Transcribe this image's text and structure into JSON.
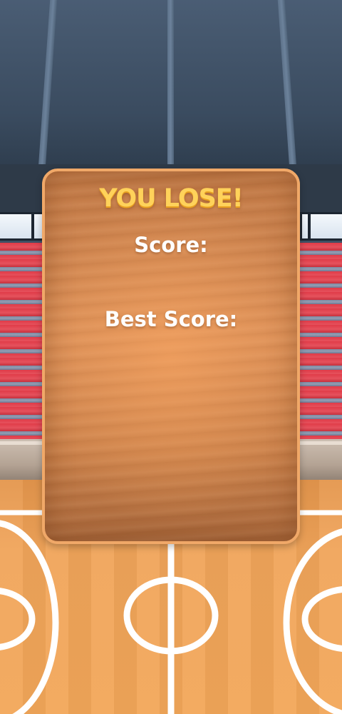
{
  "game": {
    "result_title": "YOU LOSE!",
    "score_label": "Score:",
    "score_value": "",
    "best_score_label": "Best Score:",
    "best_score_value": ""
  },
  "colors": {
    "title": "#ffd25a",
    "panel_border": "#f0a868",
    "panel_wood": "#d98e57",
    "court_floor": "#f0a45a",
    "stands_red": "#e03b48"
  },
  "icons": [
    "basketball-court-lines"
  ]
}
